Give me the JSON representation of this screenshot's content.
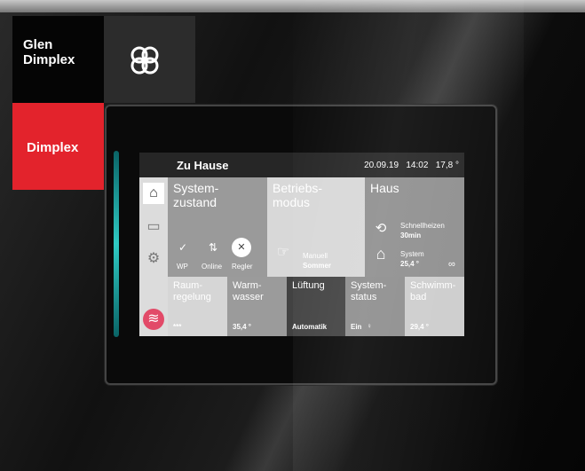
{
  "brand": {
    "top": "Glen",
    "bottom": "Dimplex",
    "red": "Dimplex"
  },
  "header": {
    "title": "Zu Hause",
    "date": "20.09.19",
    "time": "14:02",
    "temp": "17,8 °"
  },
  "sidebar": {
    "home_icon": "home-icon",
    "chart_icon": "chart-icon",
    "settings_icon": "gear-icon",
    "alert_icon": "alarm-icon"
  },
  "tiles": {
    "systemzustand": {
      "title_line1": "System-",
      "title_line2": "zustand",
      "wp": "WP",
      "online": "Online",
      "regler": "Regler"
    },
    "betriebsmodus": {
      "title_line1": "Betriebs-",
      "title_line2": "modus",
      "mode_label": "Manuell",
      "mode_value": "Sommer"
    },
    "haus": {
      "title": "Haus",
      "schnell_label": "Schnellheizen",
      "schnell_value": "30min",
      "system_label": "System",
      "system_value": "25,4 °",
      "infinity": "∞"
    },
    "raumregelung": {
      "title_line1": "Raum-",
      "title_line2": "regelung",
      "value": "***"
    },
    "warmwasser": {
      "title_line1": "Warm-",
      "title_line2": "wasser",
      "value": "35,4 °"
    },
    "lueftung": {
      "title": "Lüftung",
      "value": "Automatik"
    },
    "systemstatus": {
      "title_line1": "System-",
      "title_line2": "status",
      "value": "Ein"
    },
    "schwimmbad": {
      "title_line1": "Schwimm-",
      "title_line2": "bad",
      "value": "29,4 °"
    }
  }
}
